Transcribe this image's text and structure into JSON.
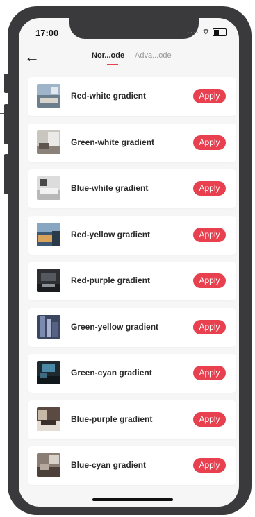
{
  "status": {
    "time": "17:00"
  },
  "nav": {
    "tabs": [
      {
        "label": "Nor...ode"
      },
      {
        "label": "Adva...ode"
      }
    ]
  },
  "items": [
    {
      "label": "Red-white gradient",
      "action": "Apply"
    },
    {
      "label": "Green-white gradient",
      "action": "Apply"
    },
    {
      "label": "Blue-white gradient",
      "action": "Apply"
    },
    {
      "label": "Red-yellow gradient",
      "action": "Apply"
    },
    {
      "label": "Red-purple gradient",
      "action": "Apply"
    },
    {
      "label": "Green-yellow gradient",
      "action": "Apply"
    },
    {
      "label": "Green-cyan gradient",
      "action": "Apply"
    },
    {
      "label": "Blue-purple gradient",
      "action": "Apply"
    },
    {
      "label": "Blue-cyan gradient",
      "action": "Apply"
    }
  ],
  "colors": {
    "accent": "#e8404f",
    "frame": "#3a3a3c",
    "background": "#f6f6f7"
  }
}
